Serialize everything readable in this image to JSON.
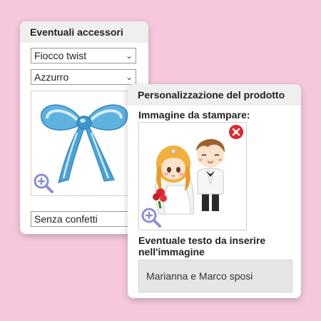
{
  "accessories": {
    "title": "Eventuali accessori",
    "bow_select": {
      "value": "Fiocco twist"
    },
    "color_select": {
      "value": "Azzurro"
    },
    "confetti_select": {
      "value": "Senza confetti"
    }
  },
  "personalization": {
    "title": "Personalizzazione del prodotto",
    "image_label": "Immagine da stampare:",
    "text_label": "Eventuale testo da inserire nell'immagine",
    "text_value": "Marianna e Marco sposi"
  },
  "icons": {
    "zoom": "zoom-in-icon",
    "remove": "remove-image-icon",
    "chevron": "chevron-down-icon"
  },
  "colors": {
    "background": "#f7c8dd",
    "zoom_icon": "#8b8ed0",
    "remove_icon": "#e0262b",
    "bow": "#5fb2e0"
  }
}
